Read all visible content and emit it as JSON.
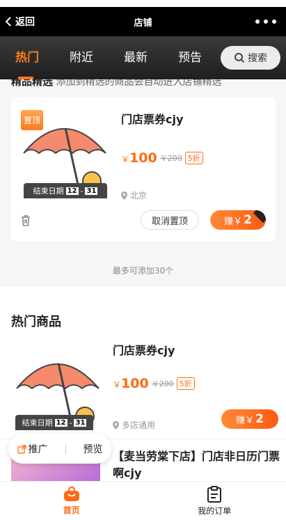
{
  "titlebar": {
    "back_label": "返回",
    "title": "店铺"
  },
  "tabs": [
    {
      "label": "热门",
      "active": true
    },
    {
      "label": "附近"
    },
    {
      "label": "最新"
    },
    {
      "label": "预告"
    }
  ],
  "search": {
    "label": "搜索"
  },
  "partial_header": {
    "title": "精品精选",
    "note": "添加到精选的商品会自动进入店铺精选"
  },
  "pinned_card": {
    "badge": "置顶",
    "title": "门店票券cjy",
    "price_symbol": "￥",
    "price": "100",
    "original_price": "￥200",
    "discount": "5折",
    "location": "北京",
    "end_label": "结束日期",
    "end_month": "12",
    "end_sep": "-",
    "end_day": "31",
    "unpin_label": "取消置顶",
    "earn_label": "赚￥",
    "earn_amount": "2"
  },
  "max_note": "最多可添加30个",
  "section2": {
    "title": "热门商品",
    "item": {
      "title": "门店票券cjy",
      "price_symbol": "￥",
      "price": "100",
      "original_price": "￥200",
      "discount": "5折",
      "location": "多店通用",
      "end_label": "结束日期",
      "end_month": "12",
      "end_sep": "-",
      "end_day": "31",
      "earn_label": "赚￥",
      "earn_amount": "2"
    },
    "item3_title": "【麦当劳棠下店】门店非日历门票啊cjy"
  },
  "float_bar": {
    "promote_label": "推广",
    "preview_label": "预览"
  },
  "bottomnav": [
    {
      "label": "首页",
      "active": true
    },
    {
      "label": "我的订单"
    }
  ],
  "colors": {
    "accent": "#ff6a10",
    "header_bg": "#000000"
  }
}
